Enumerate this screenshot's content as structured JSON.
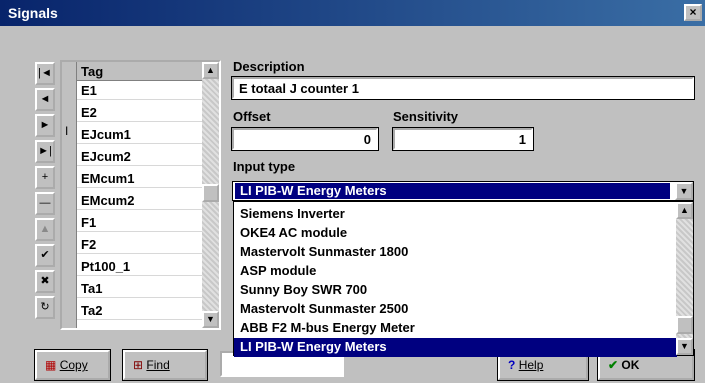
{
  "window": {
    "title": "Signals",
    "close": "×"
  },
  "nav": [
    {
      "icon": "first-record-icon",
      "glyph": "|◄"
    },
    {
      "icon": "prior-record-icon",
      "glyph": "◄"
    },
    {
      "icon": "next-record-icon",
      "glyph": "►"
    },
    {
      "icon": "last-record-icon",
      "glyph": "►|"
    },
    {
      "icon": "insert-record-icon",
      "glyph": "+"
    },
    {
      "icon": "delete-record-icon",
      "glyph": "—"
    },
    {
      "icon": "edit-record-icon",
      "glyph": "▲"
    },
    {
      "icon": "post-edit-icon",
      "glyph": "✔"
    },
    {
      "icon": "cancel-edit-icon",
      "glyph": "✖"
    },
    {
      "icon": "refresh-icon",
      "glyph": "↻"
    }
  ],
  "grid": {
    "header": "Tag",
    "current_row_marker": "I",
    "rows": [
      "E1",
      "E2",
      "EJcum1",
      "EJcum2",
      "EMcum1",
      "EMcum2",
      "F1",
      "F2",
      "Pt100_1",
      "Ta1",
      "Ta2"
    ]
  },
  "form": {
    "description_label": "Description",
    "description_value": "E totaal J counter 1",
    "offset_label": "Offset",
    "offset_value": "0",
    "sensitivity_label": "Sensitivity",
    "sensitivity_value": "1",
    "input_type_label": "Input type",
    "input_type_value": "LI PIB-W Energy Meters"
  },
  "dropdown": {
    "options": [
      "Siemens Inverter",
      "OKE4 AC module",
      "Mastervolt Sunmaster 1800",
      "ASP module",
      "Sunny Boy SWR 700",
      "Mastervolt Sunmaster 2500",
      "ABB F2 M-bus Energy Meter",
      "LI PIB-W Energy Meters"
    ],
    "selected_index": 7
  },
  "buttons": {
    "copy": "Copy",
    "find": "Find",
    "help": "Help",
    "ok": "OK"
  }
}
